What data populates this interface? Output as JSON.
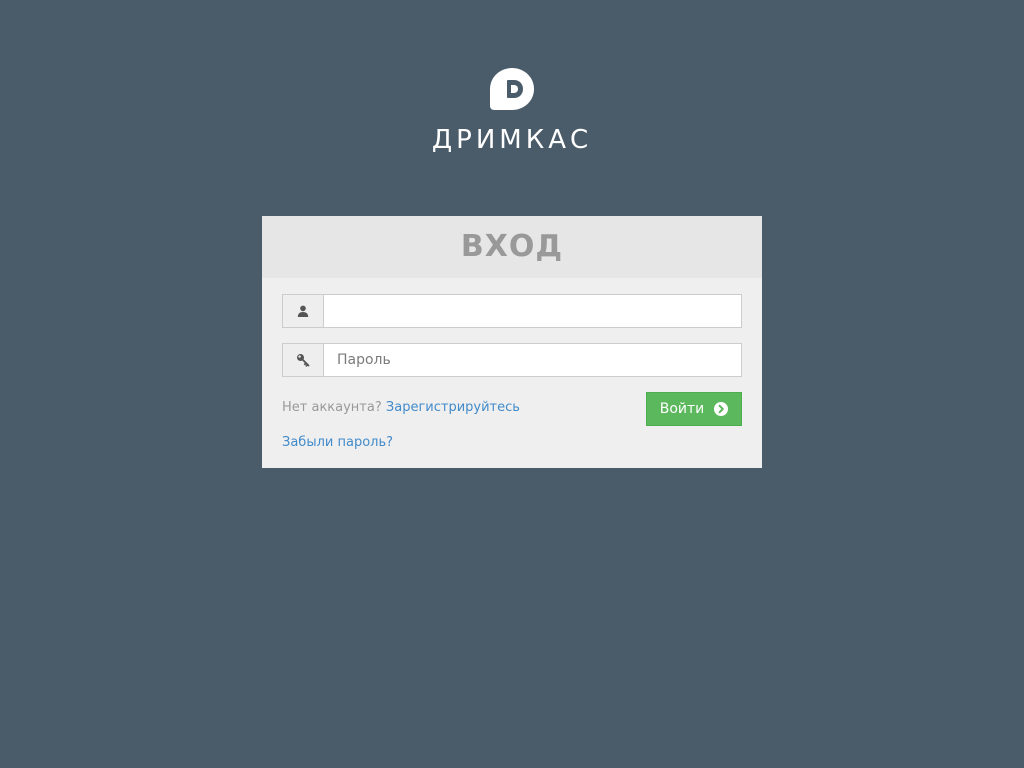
{
  "brand": {
    "name": "ДРИМКАС",
    "logo_icon": "dreamkas-logo-icon"
  },
  "login": {
    "title": "ВХОД",
    "username": {
      "icon": "user-icon",
      "value": "",
      "placeholder": ""
    },
    "password": {
      "icon": "key-icon",
      "value": "",
      "placeholder": "Пароль"
    },
    "no_account_text": "Нет аккаунта?",
    "register_link": "Зарегистрируйтесь",
    "forgot_link": "Забыли пароль?",
    "submit_label": "Войти",
    "submit_icon": "chevron-circle-right-icon"
  },
  "colors": {
    "background": "#4a5c69",
    "card": "#efefef",
    "card_header": "#e6e6e6",
    "accent_button": "#5cb85c",
    "link": "#428bca"
  }
}
